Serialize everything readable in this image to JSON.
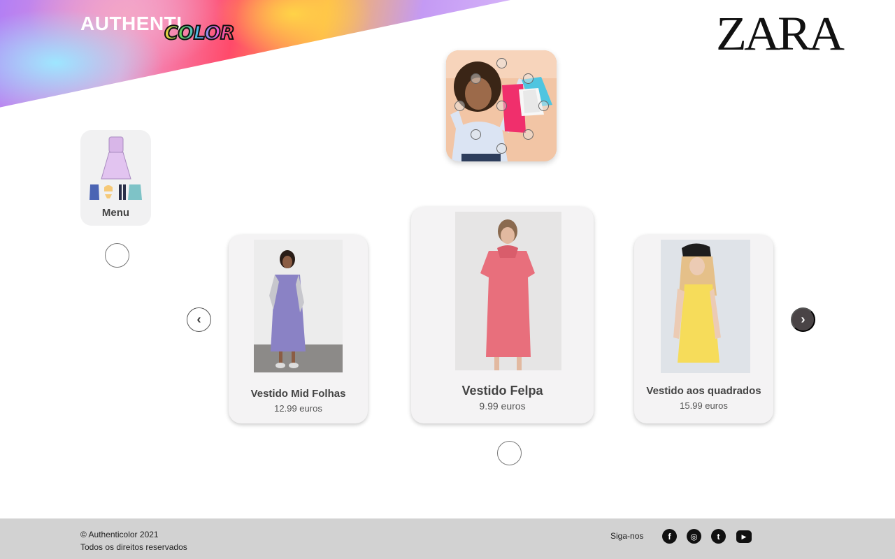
{
  "header": {
    "logo_main": "AUTHENTI",
    "logo_sub": "COLOR",
    "brand": "ZARA"
  },
  "menu": {
    "label": "Menu"
  },
  "carousel": {
    "prev_icon": "chevron-left-icon",
    "next_icon": "chevron-right-icon",
    "products": [
      {
        "name": "Vestido Mid Folhas",
        "price": "12.99 euros",
        "dress_color": "#8a82c5"
      },
      {
        "name": "Vestido Felpa",
        "price": "9.99 euros",
        "dress_color": "#e86f7c"
      },
      {
        "name": "Vestido aos quadrados",
        "price": "15.99 euros",
        "dress_color": "#f6dc5a"
      }
    ]
  },
  "footer": {
    "copyright": "© Authenticolor 2021",
    "rights": "Todos os direitos reservados",
    "follow_label": "Siga-nos",
    "social": [
      {
        "icon": "facebook-icon",
        "glyph": "f"
      },
      {
        "icon": "instagram-icon",
        "glyph": "◎"
      },
      {
        "icon": "twitter-icon",
        "glyph": "t"
      },
      {
        "icon": "youtube-icon",
        "glyph": "▶"
      }
    ]
  },
  "colors": {
    "card_bg": "#f4f3f4",
    "footer_bg": "#d2d2d2",
    "next_button": "#4a4446"
  }
}
